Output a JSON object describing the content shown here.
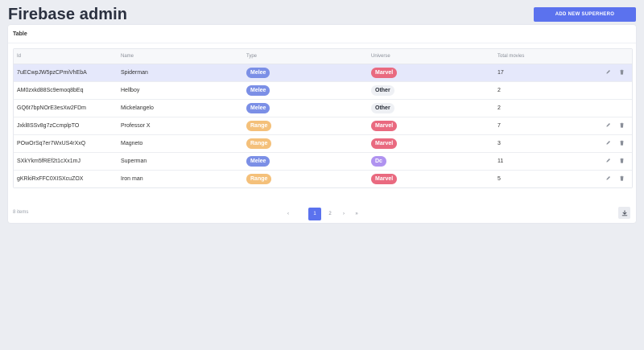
{
  "app": {
    "title": "Firebase admin"
  },
  "toolbar": {
    "add_label": "ADD NEW SUPERHERO"
  },
  "card": {
    "title": "Table"
  },
  "table": {
    "columns": {
      "id": "Id",
      "name": "Name",
      "type": "Type",
      "universe": "Universe",
      "movies": "Total movies"
    },
    "rows": [
      {
        "id": "7uECwpJW5pzCPmiVhEbA",
        "name": "Spiderman",
        "type": "Melee",
        "universe": "Marvel",
        "movies": "17",
        "selected": true
      },
      {
        "id": "AM0zxkd88Sc9emoq8bEq",
        "name": "Hellboy",
        "type": "Melee",
        "universe": "Other",
        "movies": "2"
      },
      {
        "id": "GQ6t7bpNOrE3esXw2FDm",
        "name": "Mickelangelo",
        "type": "Melee",
        "universe": "Other",
        "movies": "2"
      },
      {
        "id": "Jxkl8SSv8g7zCcmplpTO",
        "name": "Professor X",
        "type": "Range",
        "universe": "Marvel",
        "movies": "7"
      },
      {
        "id": "POwOrSq7er7WxUS4rXxQ",
        "name": "Magneto",
        "type": "Range",
        "universe": "Marvel",
        "movies": "3"
      },
      {
        "id": "SXkYkm5fREf2t1cXx1mJ",
        "name": "Superman",
        "type": "Melee",
        "universe": "Dc",
        "movies": "11"
      },
      {
        "id": "gKRkiRxFFC0XISXcuZOX",
        "name": "Iron man",
        "type": "Range",
        "universe": "Marvel",
        "movies": "5"
      }
    ]
  },
  "footer": {
    "count": "8 items"
  },
  "pagination": {
    "prev": "‹",
    "page1": "1",
    "page2": "2",
    "next": "›",
    "last": "»"
  },
  "colors": {
    "accent": "#5b72ee",
    "melee": "#7b8fe6",
    "range": "#f4c07a",
    "marvel": "#e96a80",
    "dc": "#b093f0",
    "other_bg": "#eef0f4"
  },
  "icons": {
    "edit": "pencil-icon",
    "delete": "trash-icon",
    "download": "download-icon"
  }
}
